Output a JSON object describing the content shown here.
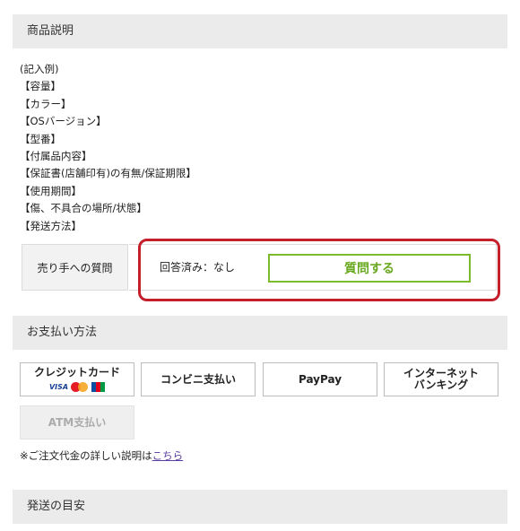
{
  "product_description": {
    "header": "商品説明",
    "lines": [
      "(記入例)",
      "【容量】",
      "【カラー】",
      "【OSバージョン】",
      "【型番】",
      "【付属品内容】",
      "【保証書(店舗印有)の有無/保証期限】",
      "【使用期間】",
      "【傷、不具合の場所/状態】",
      "【発送方法】"
    ]
  },
  "questions": {
    "label": "売り手への質問",
    "answered_text": "回答済み：なし",
    "ask_button": "質問する",
    "highlight_color": "#c41f2b",
    "button_color": "#7cbc2c"
  },
  "payment": {
    "header": "お支払い方法",
    "methods": [
      {
        "label": "クレジットカード",
        "logos": [
          "VISA",
          "Mastercard",
          "JCB"
        ]
      },
      {
        "label": "コンビニ支払い"
      },
      {
        "label": "PayPay"
      },
      {
        "label_line1": "インターネット",
        "label_line2": "バンキング"
      },
      {
        "label": "ATM支払い",
        "disabled": true
      }
    ],
    "note_prefix": "※ご注文代金の詳しい説明は",
    "note_link": "こちら"
  },
  "shipping": {
    "header": "発送の目安"
  }
}
